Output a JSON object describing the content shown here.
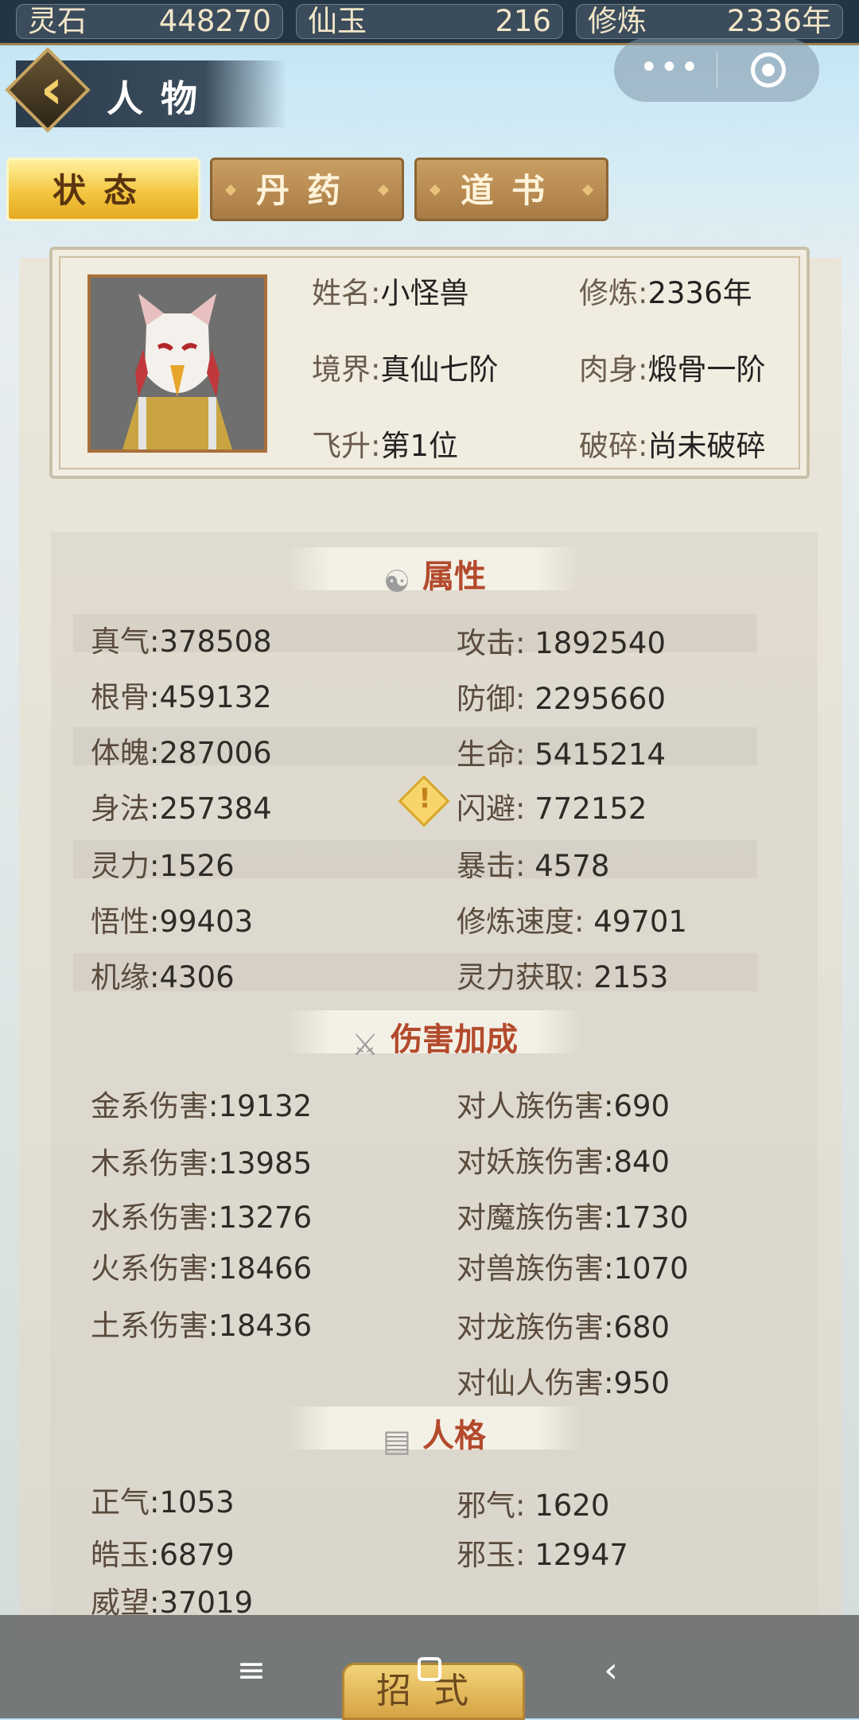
{
  "resources": [
    {
      "label": "灵石",
      "value": "448270"
    },
    {
      "label": "仙玉",
      "value": "216"
    },
    {
      "label": "修炼",
      "value": "2336年"
    }
  ],
  "header": {
    "title": "人物"
  },
  "tabs": [
    "状态",
    "丹药",
    "道书"
  ],
  "profile": {
    "name_label": "姓名:",
    "name": "小怪兽",
    "cultivation_label": "修炼:",
    "cultivation": "2336年",
    "realm_label": "境界:",
    "realm": "真仙七阶",
    "body_label": "肉身:",
    "body": "煅骨一阶",
    "ascend_label": "飞升:",
    "ascend": "第1位",
    "shatter_label": "破碎:",
    "shatter": "尚未破碎"
  },
  "sections": {
    "attributes": "属性",
    "damage": "伤害加成",
    "personality": "人格"
  },
  "attributes_left": [
    {
      "k": "真气",
      "v": ":378508"
    },
    {
      "k": "根骨",
      "v": ":459132"
    },
    {
      "k": "体魄",
      "v": ":287006"
    },
    {
      "k": "身法",
      "v": ":257384"
    },
    {
      "k": "灵力",
      "v": ":1526"
    },
    {
      "k": "悟性",
      "v": ":99403"
    },
    {
      "k": "机缘",
      "v": ":4306"
    }
  ],
  "attributes_right": [
    {
      "k": "攻击:",
      "v": " 1892540"
    },
    {
      "k": "防御:",
      "v": " 2295660"
    },
    {
      "k": "生命:",
      "v": " 5415214"
    },
    {
      "k": "闪避:",
      "v": " 772152"
    },
    {
      "k": "暴击:",
      "v": " 4578"
    },
    {
      "k": "修炼速度:",
      "v": " 49701"
    },
    {
      "k": "灵力获取:",
      "v": " 2153"
    }
  ],
  "damage_left": [
    {
      "k": "金系伤害",
      "v": ":19132"
    },
    {
      "k": "木系伤害",
      "v": ":13985"
    },
    {
      "k": "水系伤害",
      "v": ":13276"
    },
    {
      "k": "火系伤害",
      "v": ":18466"
    },
    {
      "k": "土系伤害",
      "v": ":18436"
    }
  ],
  "damage_right": [
    {
      "k": "对人族伤害",
      "v": ":690"
    },
    {
      "k": "对妖族伤害",
      "v": ":840"
    },
    {
      "k": "对魔族伤害",
      "v": ":1730"
    },
    {
      "k": "对兽族伤害",
      "v": ":1070"
    },
    {
      "k": "对龙族伤害",
      "v": ":680"
    },
    {
      "k": "对仙人伤害",
      "v": ":950"
    }
  ],
  "personality_left": [
    {
      "k": "正气",
      "v": ":1053"
    },
    {
      "k": "皓玉",
      "v": ":6879"
    },
    {
      "k": "威望",
      "v": ":37019"
    }
  ],
  "personality_right": [
    {
      "k": "邪气:",
      "v": "  1620"
    },
    {
      "k": "邪玉:",
      "v": "  12947"
    }
  ],
  "bottom_tab": "招式",
  "icons": {
    "back": "chevron-left-icon",
    "menu": "more-dots-icon",
    "close": "target-icon",
    "warn": "warning-icon",
    "nav_menu": "menu-icon",
    "nav_home": "home-square-icon",
    "nav_back": "back-arrow-icon"
  }
}
